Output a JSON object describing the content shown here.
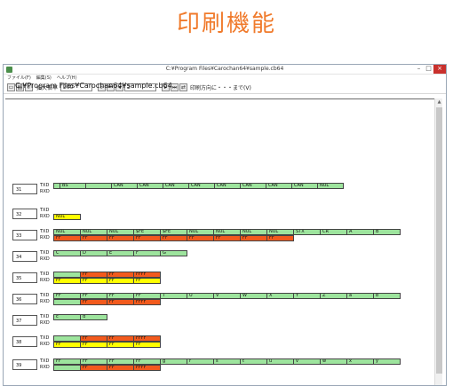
{
  "heading": "印刷機能",
  "window": {
    "title": "C:¥Program Files¥Carochan64¥sample.cb64",
    "menu": [
      "ファイル(F)",
      "編集(S)",
      "ヘルプ(H)"
    ],
    "toolbar": {
      "zoom_label": "拡大倍率",
      "zoom_value": "200",
      "page_value": "2",
      "direction_text": "印刷方向に・・・まで(V)"
    }
  },
  "file_path": "C:¥Program Files¥Carochan64¥sample.cb64",
  "colors": {
    "green": "#9de49d",
    "red": "#f25a1d",
    "yellow": "#ffff00"
  },
  "rows": [
    {
      "num": "31",
      "txd": [
        [
          "",
          "g",
          8
        ],
        [
          "BS",
          "g",
          30
        ],
        [
          "",
          "g",
          30
        ],
        [
          "CAN",
          "g",
          30
        ],
        [
          "CAN",
          "g",
          30
        ],
        [
          "CAN",
          "g",
          30
        ],
        [
          "CAN",
          "g",
          30
        ],
        [
          "CAN",
          "g",
          30
        ],
        [
          "CAN",
          "g",
          30
        ],
        [
          "CAN",
          "g",
          30
        ],
        [
          "CAN",
          "g",
          30
        ],
        [
          "NUL",
          "g",
          30
        ]
      ],
      "rxd": []
    },
    {
      "num": "32",
      "txd": [],
      "rxd": [
        [
          "NUL",
          "y",
          31
        ]
      ]
    },
    {
      "num": "33",
      "txd": [
        [
          "NUL",
          "g",
          31
        ],
        [
          "NUL",
          "g",
          31
        ],
        [
          "NUL",
          "g",
          31
        ],
        [
          "$FE",
          "g",
          31
        ],
        [
          "$FE",
          "g",
          31
        ],
        [
          "NUL",
          "g",
          31
        ],
        [
          "NUL",
          "g",
          31
        ],
        [
          "NUL",
          "g",
          31
        ],
        [
          "NUL",
          "g",
          31
        ],
        [
          "STX",
          "g",
          31
        ],
        [
          "CR",
          "g",
          31
        ],
        [
          "A",
          "g",
          31
        ],
        [
          "B",
          "g",
          31
        ]
      ],
      "rxd": [
        [
          "FF",
          "r",
          31
        ],
        [
          "FF",
          "r",
          31
        ],
        [
          "FF",
          "r",
          31
        ],
        [
          "FF",
          "r",
          31
        ],
        [
          "FF",
          "r",
          31
        ],
        [
          "FF",
          "r",
          31
        ],
        [
          "FF",
          "r",
          31
        ],
        [
          "FF",
          "r",
          31
        ],
        [
          "FF",
          "r",
          31
        ]
      ]
    },
    {
      "num": "34",
      "txd": [
        [
          "C",
          "g",
          31
        ],
        [
          "D",
          "g",
          31
        ],
        [
          "E",
          "g",
          31
        ],
        [
          "F",
          "g",
          31
        ],
        [
          "G",
          "g",
          31
        ]
      ],
      "rxd": []
    },
    {
      "num": "35",
      "txd": [
        [
          "",
          "g",
          31
        ],
        [
          "FF",
          "r",
          31
        ],
        [
          "FF",
          "r",
          31
        ],
        [
          "FFFF",
          "r",
          31
        ]
      ],
      "rxd": [
        [
          "FF",
          "y",
          31
        ],
        [
          "FF",
          "y",
          31
        ],
        [
          "FF",
          "y",
          31
        ],
        [
          "FF",
          "y",
          31
        ]
      ]
    },
    {
      "num": "36",
      "txd": [
        [
          "FF",
          "g",
          31
        ],
        [
          "FF",
          "g",
          31
        ],
        [
          "FF",
          "g",
          31
        ],
        [
          "FF",
          "g",
          31
        ],
        [
          "T",
          "g",
          31
        ],
        [
          "U",
          "g",
          31
        ],
        [
          "V",
          "g",
          31
        ],
        [
          "W",
          "g",
          31
        ],
        [
          "X",
          "g",
          31
        ],
        [
          "Y",
          "g",
          31
        ],
        [
          "Z",
          "g",
          31
        ],
        [
          "a",
          "g",
          31
        ],
        [
          "b",
          "g",
          31
        ]
      ],
      "rxd": [
        [
          "",
          "g",
          31
        ],
        [
          "FF",
          "r",
          31
        ],
        [
          "FF",
          "r",
          31
        ],
        [
          "FFFF",
          "r",
          31
        ]
      ]
    },
    {
      "num": "37",
      "txd": [
        [
          "c",
          "g",
          31
        ],
        [
          "d",
          "g",
          31
        ]
      ],
      "rxd": []
    },
    {
      "num": "38",
      "txd": [
        [
          "",
          "g",
          31
        ],
        [
          "FF",
          "r",
          31
        ],
        [
          "FF",
          "r",
          31
        ],
        [
          "FFFF",
          "r",
          31
        ]
      ],
      "rxd": [
        [
          "FF",
          "y",
          31
        ],
        [
          "FF",
          "y",
          31
        ],
        [
          "FF",
          "y",
          31
        ],
        [
          "FF",
          "y",
          31
        ]
      ]
    },
    {
      "num": "39",
      "txd": [
        [
          "FF",
          "g",
          31
        ],
        [
          "FF",
          "g",
          31
        ],
        [
          "FF",
          "g",
          31
        ],
        [
          "FF",
          "g",
          31
        ],
        [
          "g",
          "g",
          31
        ],
        [
          "r",
          "g",
          31
        ],
        [
          "s",
          "g",
          31
        ],
        [
          "t",
          "g",
          31
        ],
        [
          "u",
          "g",
          31
        ],
        [
          "v",
          "g",
          31
        ],
        [
          "w",
          "g",
          31
        ],
        [
          "x",
          "g",
          31
        ],
        [
          "y",
          "g",
          31
        ]
      ],
      "rxd": [
        [
          "",
          "g",
          31
        ],
        [
          "FF",
          "r",
          31
        ],
        [
          "FF",
          "r",
          31
        ],
        [
          "FFFF",
          "r",
          31
        ]
      ]
    }
  ],
  "labels": {
    "txd": "TXD",
    "rxd": "RXD"
  }
}
